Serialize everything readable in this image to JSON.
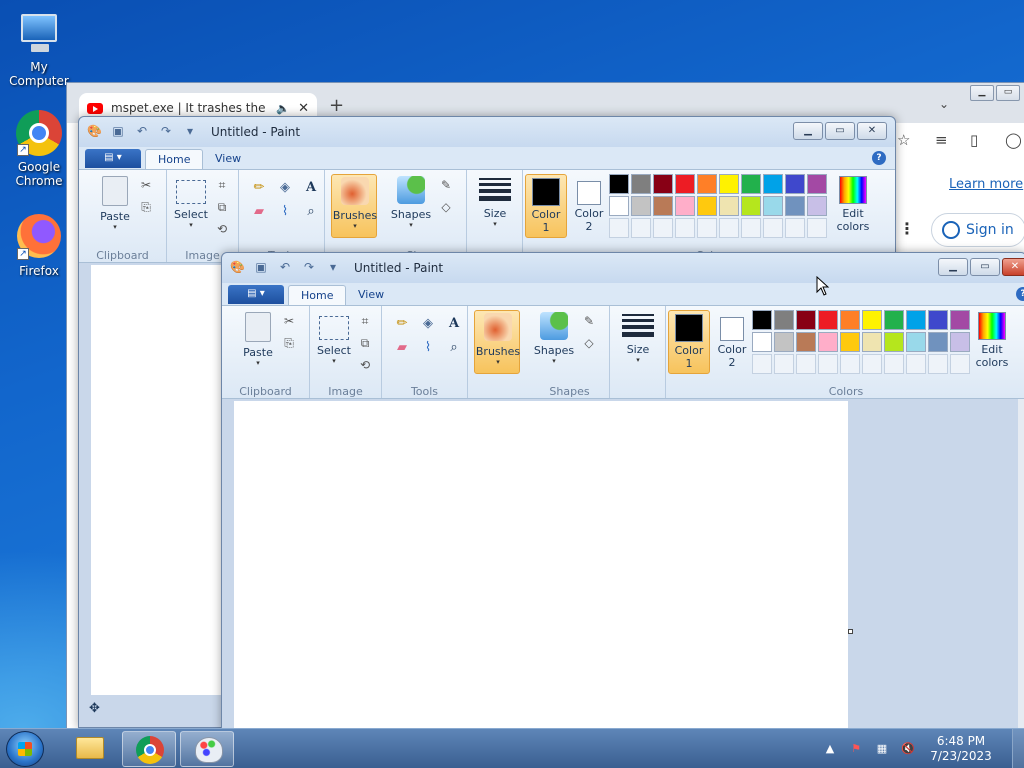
{
  "desktop": {
    "icons": [
      {
        "label": "My Computer"
      },
      {
        "label": "Google Chrome"
      },
      {
        "label": "Firefox"
      }
    ]
  },
  "chrome": {
    "tab_title": "mspet.exe | It trashes the sys",
    "learn_more": "Learn more",
    "sign_in": "Sign in"
  },
  "paint_back": {
    "title": "Untitled - Paint"
  },
  "paint_front": {
    "title": "Untitled - Paint"
  },
  "ribbon": {
    "tabs": {
      "home": "Home",
      "view": "View"
    },
    "clipboard": {
      "paste": "Paste",
      "group": "Clipboard"
    },
    "image": {
      "select": "Select",
      "group": "Image"
    },
    "tools": {
      "group": "Tools"
    },
    "brushes": "Brushes",
    "shapes": {
      "label": "Shapes",
      "group": "Shapes"
    },
    "size": "Size",
    "color1": {
      "line1": "Color",
      "line2": "1"
    },
    "color2": {
      "line1": "Color",
      "line2": "2"
    },
    "colors_group": "Colors",
    "edit_colors": {
      "line1": "Edit",
      "line2": "colors"
    }
  },
  "palette_row1": [
    "#000000",
    "#7f7f7f",
    "#880015",
    "#ed1c24",
    "#ff7f27",
    "#fff200",
    "#22b14c",
    "#00a2e8",
    "#3f48cc",
    "#a349a4"
  ],
  "palette_row2": [
    "#ffffff",
    "#c3c3c3",
    "#b97a57",
    "#ffaec9",
    "#ffc90e",
    "#efe4b0",
    "#b5e61d",
    "#99d9ea",
    "#7092be",
    "#c8bfe7"
  ],
  "selected_colors": {
    "color1": "#000000",
    "color2": "#ffffff"
  },
  "taskbar": {
    "time": "6:48 PM",
    "date": "7/23/2023"
  }
}
